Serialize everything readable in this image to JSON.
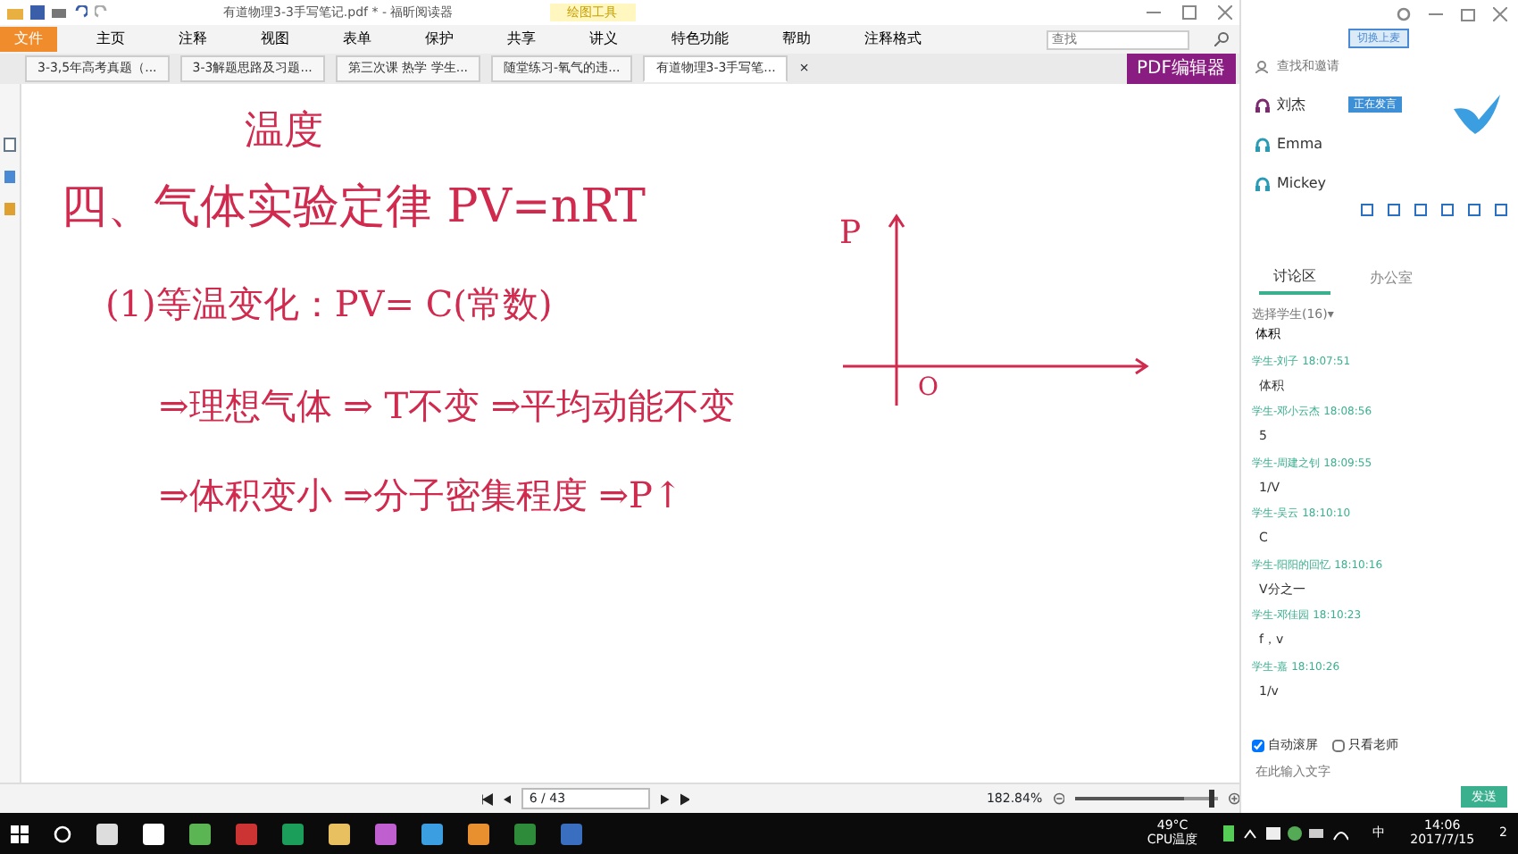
{
  "window": {
    "title": "有道物理3-3手写笔记.pdf * - 福昕阅读器",
    "context_tab": "绘图工具"
  },
  "menu": [
    {
      "label": "文件",
      "selected": true
    },
    {
      "label": "主页",
      "selected": false
    },
    {
      "label": "注释",
      "selected": false
    },
    {
      "label": "视图",
      "selected": false
    },
    {
      "label": "表单",
      "selected": false
    },
    {
      "label": "保护",
      "selected": false
    },
    {
      "label": "共享",
      "selected": false
    },
    {
      "label": "讲义",
      "selected": false
    },
    {
      "label": "特色功能",
      "selected": false
    },
    {
      "label": "帮助",
      "selected": false
    },
    {
      "label": "注释格式",
      "selected": false
    }
  ],
  "search": {
    "placeholder": "查找"
  },
  "doc_tabs": [
    {
      "label": "3-3,5年高考真题（...",
      "selected": false
    },
    {
      "label": "3-3解题思路及习题...",
      "selected": false
    },
    {
      "label": "第三次课 热学 学生...",
      "selected": false
    },
    {
      "label": "随堂练习-氧气的违...",
      "selected": false
    },
    {
      "label": "有道物理3-3手写笔...",
      "selected": true
    }
  ],
  "close_tab": "×",
  "pdf_editor_button": "PDF编辑器",
  "notes": [
    {
      "kind": "subtitle",
      "text": "温度"
    },
    {
      "kind": "title",
      "text": "四、气体实验定律  PV=nRT"
    },
    {
      "kind": "line",
      "text": "(1)等温变化：PV= C(常数)"
    },
    {
      "kind": "point",
      "text": "⇒理想气体 ⇒ T不变 ⇒平均动能不变"
    },
    {
      "kind": "point",
      "text": "⇒体积变小 ⇒分子密集程度 ⇒P↑"
    }
  ],
  "graph": {
    "y_label": "P",
    "origin": "O"
  },
  "pager": {
    "page": "6 / 43",
    "zoom": "182.84%",
    "level": 0.77
  },
  "side_panel": {
    "switch_button": "切换上麦",
    "search_placeholder": "查找和邀请",
    "members": [
      {
        "name": "刘杰",
        "color": "#7a2a6e",
        "badge": "正在发言"
      },
      {
        "name": "Emma",
        "color": "#2a9bb5"
      },
      {
        "name": "Mickey",
        "color": "#2a9bb5"
      }
    ],
    "tabs": [
      {
        "label": "讨论区",
        "selected": true
      },
      {
        "label": "办公室",
        "selected": false
      }
    ],
    "filter": "选择学生(16)▾",
    "filter_value": "体积",
    "messages": [
      {
        "sender": "学生-刘子",
        "time": "18:07:51",
        "text": "体积"
      },
      {
        "sender": "学生-邓小云杰",
        "time": "18:08:56",
        "text": "5"
      },
      {
        "sender": "学生-周建之钊",
        "time": "18:09:55",
        "text": "1/V"
      },
      {
        "sender": "学生-吴云",
        "time": "18:10:10",
        "text": "C"
      },
      {
        "sender": "学生-阳阳的回忆",
        "time": "18:10:16",
        "text": "V分之一"
      },
      {
        "sender": "学生-邓佳园",
        "time": "18:10:23",
        "text": "f，v"
      },
      {
        "sender": "学生-嘉",
        "time": "18:10:26",
        "text": "1/v"
      }
    ],
    "auto_scroll": {
      "label": "自动滚屏",
      "checked": true
    },
    "teacher_only": {
      "label": "只看老师",
      "checked": false
    },
    "input_placeholder": "在此输入文字",
    "send": "发送"
  },
  "taskbar": {
    "temp": "49°C",
    "temp_label": "CPU温度",
    "ime": "中",
    "time": "14:06",
    "date": "2017/7/15",
    "notifications": "2"
  }
}
